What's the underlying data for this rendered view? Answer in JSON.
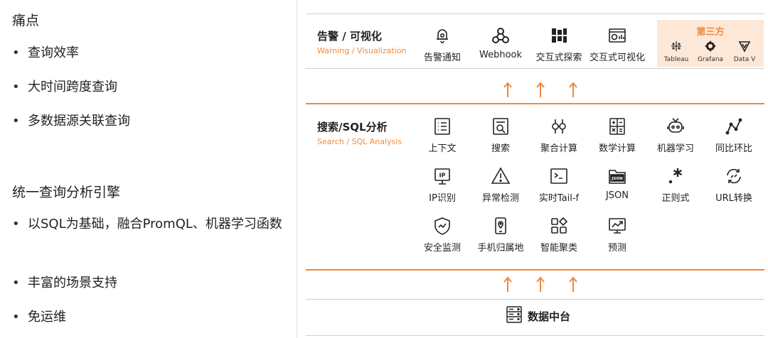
{
  "left": {
    "heading1": "痛点",
    "bullets1": [
      "查询效率",
      "大时间跨度查询",
      "多数据源关联查询"
    ],
    "heading2": "统一查询分析引擎",
    "bullets2": [
      "以SQL为基础，融合PromQL、机器学习函数",
      "丰富的场景支持",
      "免运维"
    ],
    "bullet_symbol": "•"
  },
  "alert": {
    "title": "告警 / 可视化",
    "subtitle": "Warning / Visualization",
    "items": [
      "告警通知",
      "Webhook",
      "交互式探索",
      "交互式可视化"
    ]
  },
  "third_party": {
    "title": "第三方",
    "items": [
      "Tableau",
      "Grafana",
      "Data V"
    ]
  },
  "search": {
    "title": "搜索/SQL分析",
    "subtitle": "Search / SQL Analysis",
    "row1": [
      "上下文",
      "搜索",
      "聚合计算",
      "数学计算",
      "机器学习",
      "同比环比"
    ],
    "row2": [
      "IP识别",
      "异常检测",
      "实时Tail-f",
      "JSON",
      "正则式",
      "URL转换"
    ],
    "row3": [
      "安全监测",
      "手机归属地",
      "智能聚类",
      "预测"
    ]
  },
  "bottom": {
    "label": "数据中台"
  },
  "colors": {
    "accent": "#f0883a",
    "third_bg": "#fde7d6"
  }
}
